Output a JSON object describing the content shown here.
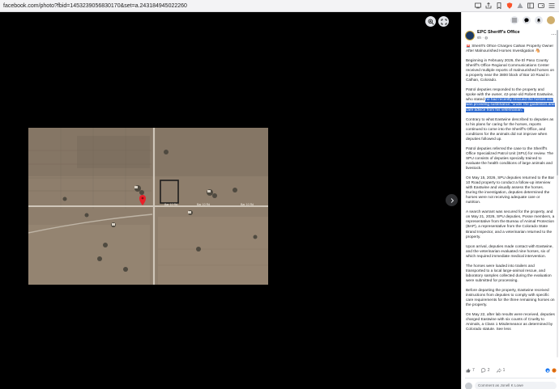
{
  "browser": {
    "url": "facebook.com/photo?fbid=1453239056830170&set=a.243184945022260",
    "icons": [
      "screen-mirror-icon",
      "share-icon",
      "bookmark-icon",
      "brave-shield-icon",
      "brave-rewards-icon",
      "sidebar-icon",
      "wallet-icon",
      "menu-icon"
    ]
  },
  "viewer": {
    "background": "#000000",
    "photo_description_icon": "map-pin-icon",
    "controls": [
      "zoom-in-icon",
      "fullscreen-icon",
      "next-arrow-icon"
    ],
    "road_labels": [
      "Bar 10 Rd",
      "Bar 10 Rd",
      "Bar 10 Rd"
    ]
  },
  "panel": {
    "top_icons": [
      "grid-icon",
      "messenger-icon",
      "bell-icon",
      "profile-avatar"
    ],
    "page_name": "EPC Sheriff's Office",
    "post_time": "6h · ",
    "title_line": "🚨 Sheriff's Office Charges Calhan Property Owner After Malnourished Horses Investigation 🐴",
    "paragraphs": [
      {
        "text": "Beginning in February 2026, the El Paso County Sheriff's Office Regional Communications Center received multiple reports of malnourished horses on a property near the 3800 block of Bar 10 Road in Calhan, Colorado.",
        "highlight": ""
      },
      {
        "text": "Patrol deputies responded to the property and spoke with the owner, 42-year-old Robert Eastwine, who stated ",
        "highlight": "he had recently rescued the horses and was providing sustenance \"under the guidelines and care advice from his veterinarian.\""
      },
      {
        "text": "Contrary to what Eastwine described to deputies as to his plans for caring for the horses, reports continued to come into the Sheriff's Office, and conditions for the animals did not improve when deputies followed up.",
        "highlight": ""
      },
      {
        "text": "Patrol deputies referred the case to the Sheriff's Office Specialized Patrol Unit (SPU) for review. The SPU consists of deputies specially trained to evaluate the health conditions of large animals and livestock.",
        "highlight": ""
      },
      {
        "text": "On May 15, 2026, SPU deputies returned to the Bar 10 Road property to conduct a follow-up interview with Eastwine and visually assess the horses. During the investigation, deputies determined the horses were not receiving adequate care or nutrition.",
        "highlight": ""
      },
      {
        "text": "A search warrant was secured for the property, and on May 21, 2026, SPU deputies, Posse members, a representative from the Bureau of Animal Protection (BAP), a representative from the Colorado State Brand Inspector, and a veterinarian returned to the property.",
        "highlight": ""
      },
      {
        "text": "Upon arrival, deputies made contact with Eastwine, and the veterinarian evaluated nine horses, six of which required immediate medical intervention.",
        "highlight": ""
      },
      {
        "text": "The horses were loaded into trailers and transported to a local large-animal rescue, and laboratory samples collected during the evaluation were submitted for processing.",
        "highlight": ""
      },
      {
        "text": "Before departing the property, Eastwine received instructions from deputies to comply with specific care requirements for the three remaining horses on the property.",
        "highlight": ""
      },
      {
        "text": "On May 22, after lab results were received, deputies charged Eastwine with six counts of Cruelty to Animals, a Class 1 Misdemeanor as determined by Colorado statute. See less",
        "highlight": ""
      }
    ],
    "engagement": {
      "likes": "7",
      "comments": "2",
      "shares": "1"
    },
    "comment_placeholder": "Comment as Jonell K Lowe"
  }
}
